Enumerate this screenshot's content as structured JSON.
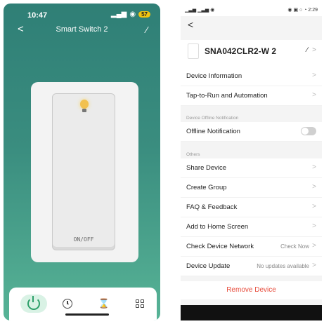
{
  "left": {
    "status": {
      "time": "10:47",
      "signal": "▂▄▆",
      "wifi": "◉",
      "battery": "57"
    },
    "header": {
      "back": "<",
      "title": "Smart Switch 2",
      "edit": "∕"
    },
    "switch": {
      "label": "ON/OFF"
    },
    "tabs": [
      {
        "name": "power",
        "active": true
      },
      {
        "name": "timer-clock"
      },
      {
        "name": "countdown-hourglass",
        "glyph": "⌛"
      },
      {
        "name": "more-grid"
      }
    ]
  },
  "right": {
    "status": {
      "left": "▁▃▅ ▁▃▅ ◉",
      "right": "◉ ▣ ○ ◔ 2:29"
    },
    "back": "<",
    "device": {
      "name": "SNA042CLR2-W 2",
      "edit": "∕",
      "chevron": ">"
    },
    "group1": [
      {
        "label": "Device Information",
        "chevron": ">"
      },
      {
        "label": "Tap-to-Run and Automation",
        "chevron": ">"
      }
    ],
    "section_offline": "Device Offline Notification",
    "offline_row": {
      "label": "Offline Notification"
    },
    "section_others": "Others",
    "group2": [
      {
        "label": "Share Device",
        "chevron": ">"
      },
      {
        "label": "Create Group",
        "chevron": ">"
      },
      {
        "label": "FAQ & Feedback",
        "chevron": ">"
      },
      {
        "label": "Add to Home Screen",
        "chevron": ">"
      },
      {
        "label": "Check Device Network",
        "value": "Check Now",
        "chevron": ">"
      },
      {
        "label": "Device Update",
        "value": "No updates available",
        "chevron": ">"
      }
    ],
    "remove": "Remove Device"
  }
}
